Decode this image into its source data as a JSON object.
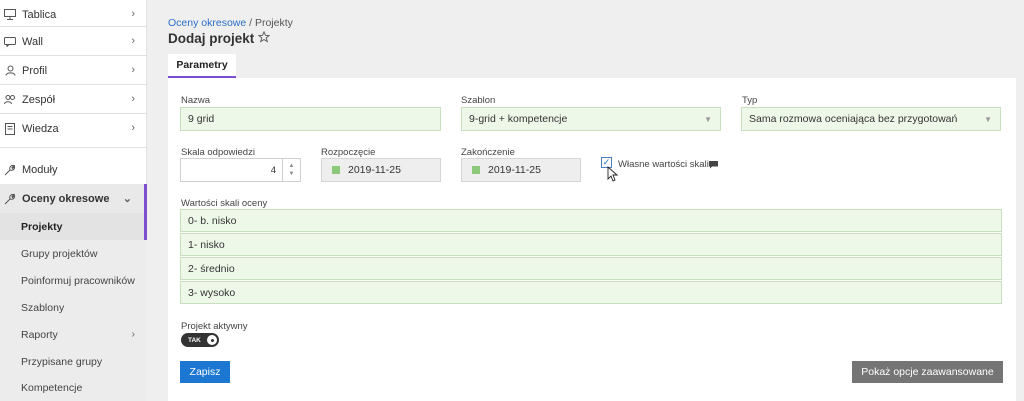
{
  "sidebar": {
    "items": [
      {
        "label": "Tablica",
        "icon": "monitor-icon"
      },
      {
        "label": "Wall",
        "icon": "wall-icon"
      },
      {
        "label": "Profil",
        "icon": "user-icon"
      },
      {
        "label": "Zespół",
        "icon": "team-icon"
      },
      {
        "label": "Wiedza",
        "icon": "book-icon"
      },
      {
        "label": "Moduły",
        "icon": "wrench-icon"
      },
      {
        "label": "Oceny okresowe",
        "icon": "wrench-icon"
      }
    ],
    "subitems": [
      {
        "label": "Projekty"
      },
      {
        "label": "Grupy projektów"
      },
      {
        "label": "Poinformuj pracowników"
      },
      {
        "label": "Szablony"
      },
      {
        "label": "Raporty"
      },
      {
        "label": "Przypisane grupy"
      },
      {
        "label": "Kompetencje"
      }
    ]
  },
  "header": {
    "breadcrumb_link": "Oceny okresowe",
    "breadcrumb_rest": " / Projekty",
    "title": "Dodaj projekt"
  },
  "tabs": [
    {
      "label": "Parametry"
    }
  ],
  "form": {
    "name_label": "Nazwa",
    "name_value": "9 grid",
    "template_label": "Szablon",
    "template_value": "9-grid + kompetencje",
    "type_label": "Typ",
    "type_value": "Sama rozmowa oceniająca bez przygotowań",
    "scale_label": "Skala odpowiedzi",
    "scale_value": "4",
    "start_label": "Rozpoczęcie",
    "start_value": "2019-11-25",
    "end_label": "Zakończenie",
    "end_value": "2019-11-25",
    "custom_scale_label": "Własne wartości skali",
    "custom_scale_checked": true,
    "scale_values_label": "Wartości skali oceny",
    "scale_values": [
      "0- b. nisko",
      "1- nisko",
      "2- średnio",
      "3- wysoko"
    ],
    "active_label": "Projekt aktywny",
    "active_toggle": "TAK"
  },
  "actions": {
    "save": "Zapisz",
    "advanced": "Pokaż opcje zaawansowane"
  },
  "colors": {
    "accent": "#7b4fd0",
    "primary_button": "#1b77d2",
    "field_bg": "#eef8e9"
  }
}
